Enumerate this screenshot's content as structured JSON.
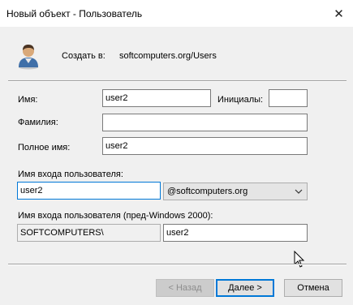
{
  "window": {
    "title": "Новый объект - Пользователь",
    "close_icon": "close-icon"
  },
  "header": {
    "icon": "user-icon",
    "create_in_label": "Создать в:",
    "create_in_value": "softcomputers.org/Users"
  },
  "form": {
    "first_name_label": "Имя:",
    "first_name_value": "user2",
    "initials_label": "Инициалы:",
    "initials_value": "",
    "last_name_label": "Фамилия:",
    "last_name_value": "",
    "full_name_label": "Полное имя:",
    "full_name_value": "user2",
    "logon_name_label": "Имя входа пользователя:",
    "logon_name_value": "user2",
    "domain_value": "@softcomputers.org",
    "pre2000_label": "Имя входа пользователя (пред-Windows 2000):",
    "pre2000_domain_value": "SOFTCOMPUTERS\\",
    "pre2000_name_value": "user2"
  },
  "buttons": {
    "back": "< Назад",
    "next": "Далее >",
    "cancel": "Отмена"
  },
  "colors": {
    "focus_border": "#0078d7",
    "dialog_bg": "#f0f0f0"
  }
}
